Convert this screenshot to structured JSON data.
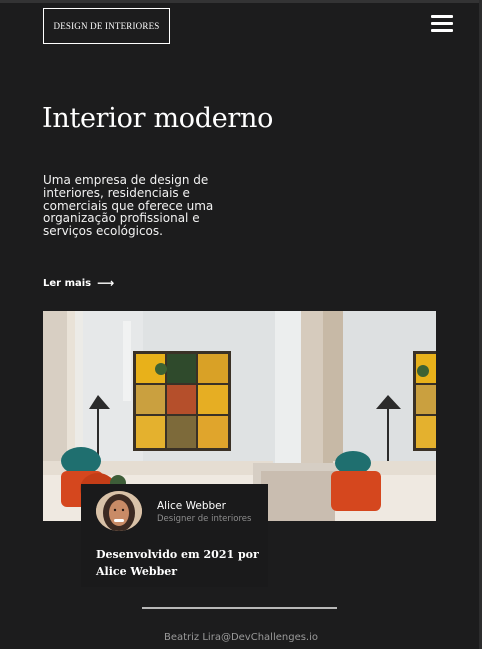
{
  "header": {
    "logo_text": "DESIGN DE INTERIORES",
    "menu_icon": "hamburger-menu-icon"
  },
  "hero": {
    "title": "Interior moderno",
    "description": "Uma empresa de design de interiores, residenciais e comerciais que oferece uma organização profissional e serviços ecológicos.",
    "read_more_label": "Ler mais",
    "read_more_icon": "arrow-right-icon"
  },
  "card": {
    "name": "Alice Webber",
    "role": "Designer de interiores",
    "credit": "Desenvolvido em 2021 por Alice Webber"
  },
  "footer": {
    "text": "Beatriz Lira@DevChallenges.io"
  },
  "colors": {
    "background": "#1c1c1d",
    "text": "#ffffff",
    "muted": "#8d8d8d"
  }
}
